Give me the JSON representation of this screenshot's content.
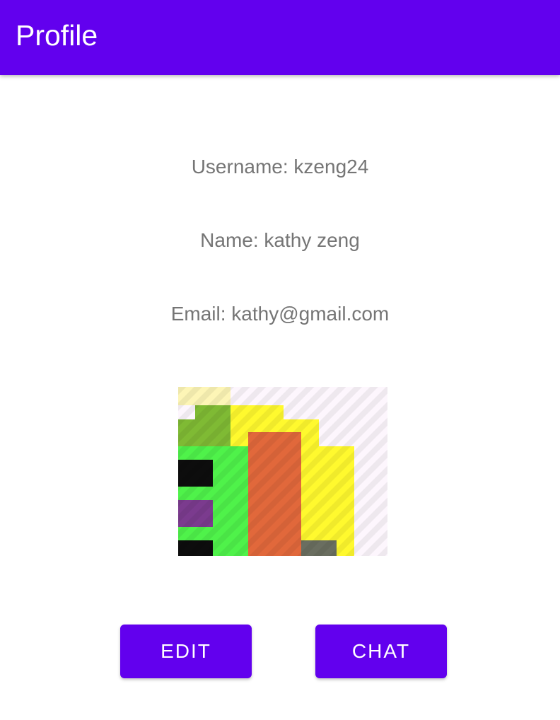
{
  "app_bar": {
    "title": "Profile"
  },
  "profile": {
    "username_line": "Username: kzeng24",
    "name_line": "Name: kathy zeng",
    "email_line": "Email: kathy@gmail.com"
  },
  "actions": {
    "edit_label": "EDIT",
    "chat_label": "CHAT"
  },
  "colors": {
    "primary": "#6200ee",
    "text_secondary": "#757575"
  },
  "avatar": {
    "icon": "profile-picture-image"
  }
}
